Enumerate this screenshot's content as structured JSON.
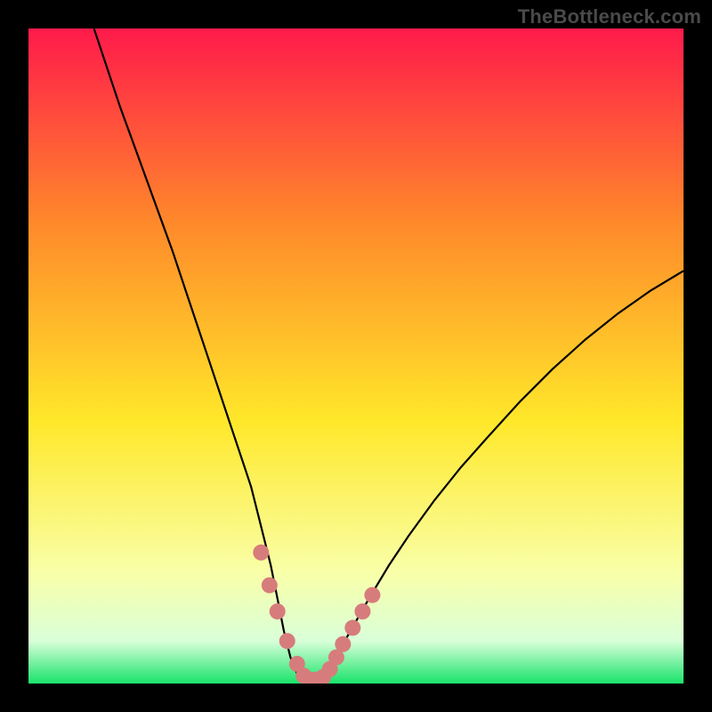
{
  "watermark": "TheBottleneck.com",
  "colors": {
    "frame": "#000000",
    "curve": "#000000",
    "markers": "#d77c7c",
    "gradient_top": "#ff1a4b",
    "gradient_upper": "#ff8a2a",
    "gradient_mid": "#ffe82a",
    "gradient_lower": "#f9ffa8",
    "gradient_band": "#d9ffd9",
    "gradient_bottom": "#19e36a"
  },
  "chart_data": {
    "type": "line",
    "title": "",
    "xlabel": "",
    "ylabel": "",
    "xlim": [
      0,
      100
    ],
    "ylim": [
      0,
      100
    ],
    "series": [
      {
        "name": "bottleneck-curve",
        "x": [
          10,
          12,
          14,
          16,
          18,
          20,
          22,
          24,
          26,
          28,
          30,
          32,
          33,
          34,
          35,
          36,
          37,
          38,
          39,
          40,
          41,
          42,
          43,
          44,
          45,
          46,
          48,
          50,
          52,
          55,
          58,
          62,
          66,
          70,
          75,
          80,
          85,
          90,
          95,
          100
        ],
        "y": [
          100,
          94,
          88,
          82.5,
          77,
          71.5,
          66,
          60,
          54,
          48,
          42,
          36,
          33,
          30,
          26,
          22,
          18,
          13,
          8,
          4,
          1.5,
          0.5,
          0.3,
          0.5,
          1.2,
          2.8,
          6,
          9.5,
          13,
          18,
          22.5,
          28,
          33,
          37.5,
          43,
          48,
          52.5,
          56.5,
          60,
          63
        ]
      }
    ],
    "markers": {
      "name": "highlight-band",
      "x": [
        35.5,
        36.8,
        38,
        39.5,
        41,
        42,
        43,
        44,
        45,
        46,
        47,
        48,
        49.5,
        51,
        52.5
      ],
      "y": [
        20,
        15,
        11,
        6.5,
        3,
        1.2,
        0.6,
        0.6,
        1,
        2.2,
        4,
        6,
        8.5,
        11,
        13.5
      ]
    }
  }
}
